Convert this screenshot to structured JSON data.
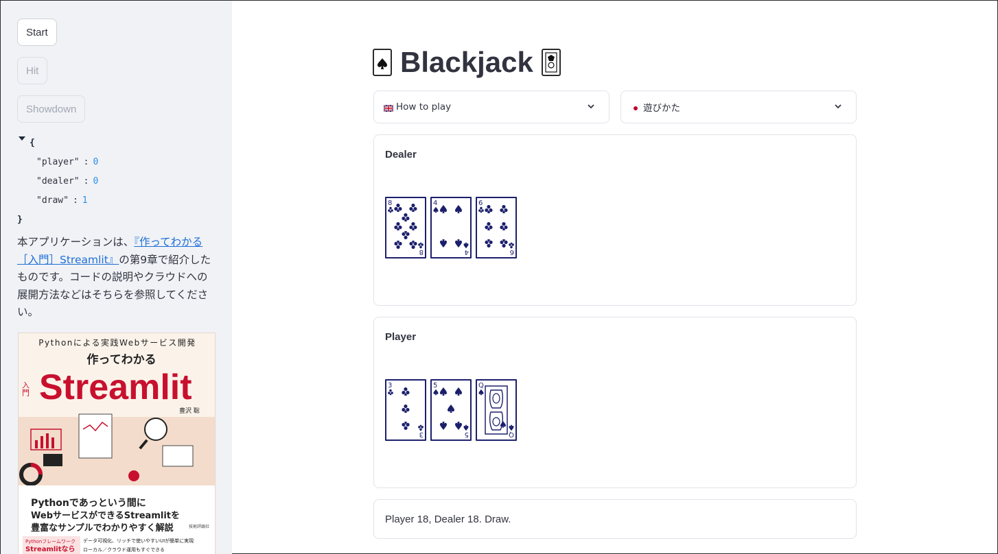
{
  "sidebar": {
    "buttons": {
      "start": "Start",
      "hit": "Hit",
      "showdown": "Showdown"
    },
    "json_view": {
      "open": "{",
      "close": "}",
      "rows": [
        {
          "key": "\"player\"",
          "value": "0"
        },
        {
          "key": "\"dealer\"",
          "value": "0"
        },
        {
          "key": "\"draw\"",
          "value": "1"
        }
      ]
    },
    "description": {
      "prefix": "本アプリケーションは、",
      "link": "『作ってわかる［入門］Streamlit』",
      "suffix": "の第9章で紹介したものです。コードの説明やクラウドへの展開方法などはそちらを参照してください。"
    },
    "book": {
      "top_line": "Pythonによる実践Webサービス開発",
      "subtitle": "作ってわかる",
      "badge": "入門",
      "title": "Streamlit",
      "author": "豊沢 聡",
      "tagline_1": "Pythonであっという間に",
      "tagline_2": "WebサービスができるStreamlitを",
      "tagline_3": "豊富なサンプルでわかりやすく解説",
      "publisher": "技術評論社",
      "footer_left_1": "Pythonフレームワーク",
      "footer_left_2": "Streamlitなら",
      "footer_right_1": "データ可視化、リッチで使いやすいUIが簡単に実現",
      "footer_right_2": "ローカル／クラウド運用もすぐできる",
      "accent": "#c8102e"
    }
  },
  "main": {
    "title": "Blackjack",
    "expanders": [
      {
        "label": "How to play",
        "flag": "uk-flag-icon"
      },
      {
        "label": "遊びかた",
        "flag": "japan-flag-icon"
      }
    ],
    "dealer": {
      "label": "Dealer",
      "cards": [
        {
          "rank": "8",
          "suit": "club"
        },
        {
          "rank": "4",
          "suit": "spade"
        },
        {
          "rank": "6",
          "suit": "club"
        }
      ]
    },
    "player": {
      "label": "Player",
      "cards": [
        {
          "rank": "3",
          "suit": "club"
        },
        {
          "rank": "5",
          "suit": "spade"
        },
        {
          "rank": "Q",
          "suit": "spade"
        }
      ]
    },
    "result": "Player 18, Dealer 18. Draw."
  },
  "colors": {
    "card_ink": "#1b1f6b",
    "link": "#1f6fd6",
    "sidebar_bg": "#f0f2f6",
    "json_number": "#2e8ee0"
  }
}
